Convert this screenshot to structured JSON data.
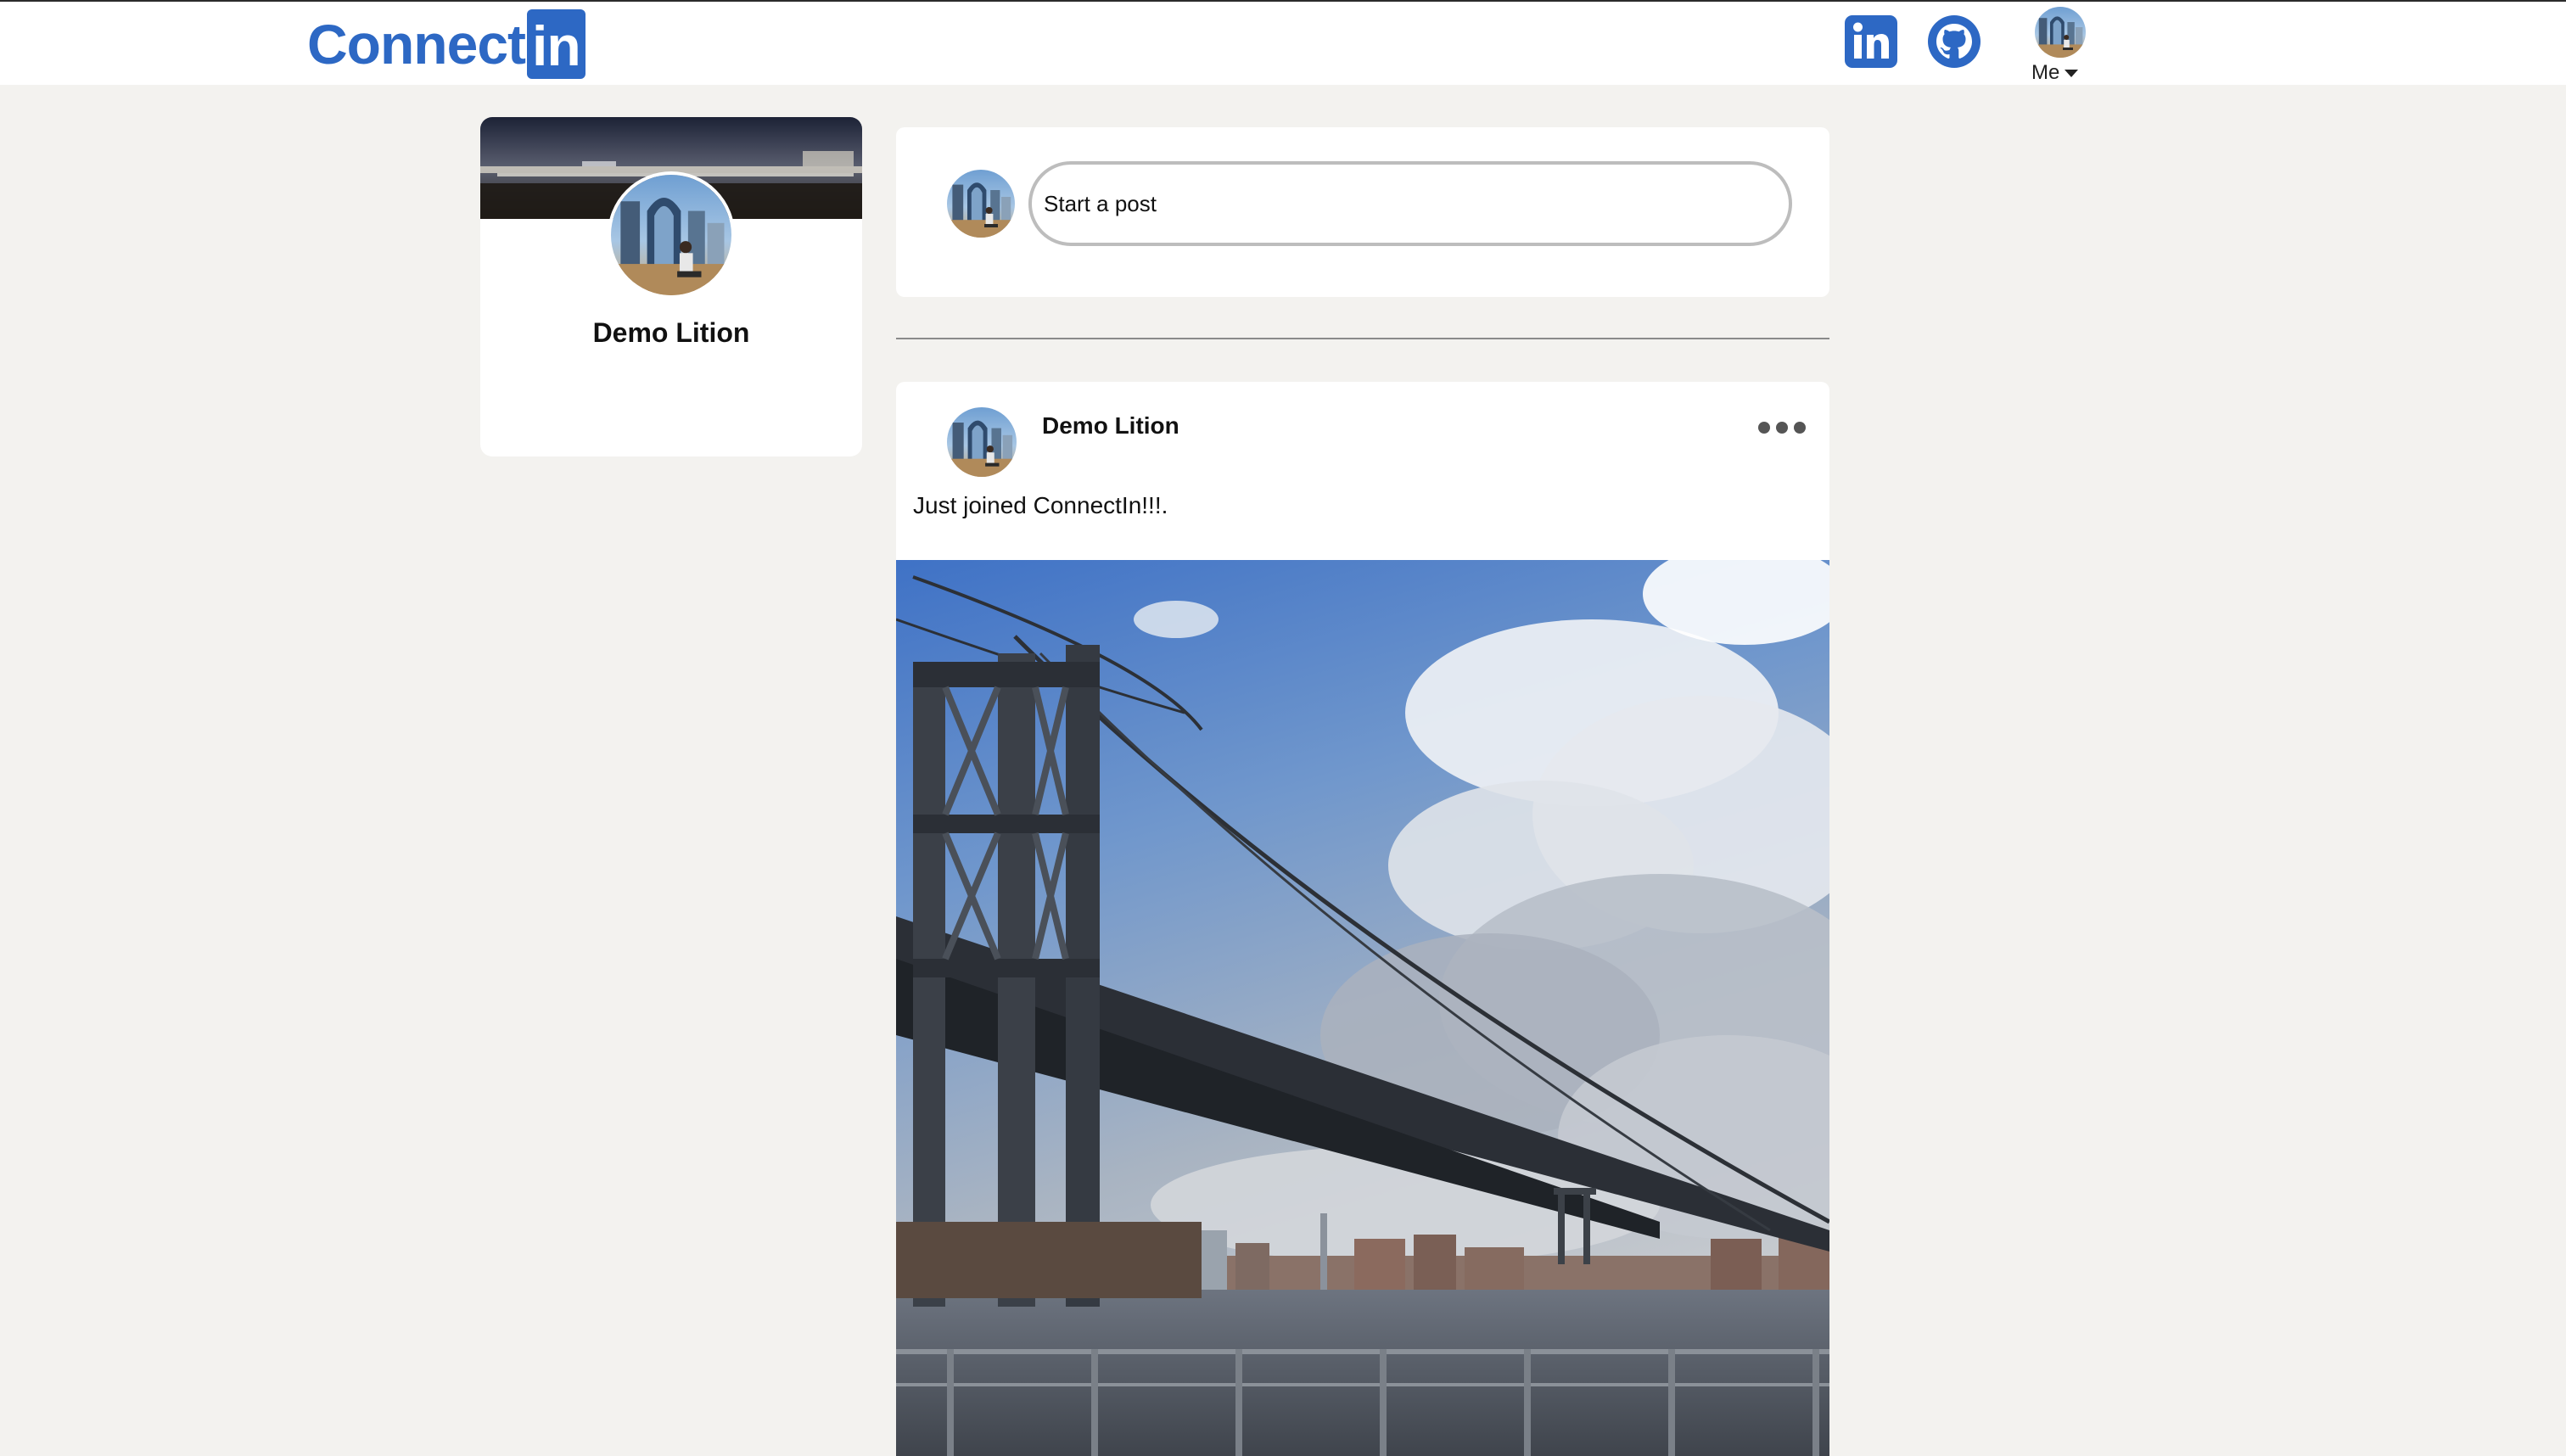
{
  "header": {
    "logo_text": "Connect",
    "logo_box_text": "in",
    "linkedin_icon": "linkedin-icon",
    "github_icon": "github-icon",
    "me_label": "Me"
  },
  "profile": {
    "name": "Demo Lition"
  },
  "composer": {
    "placeholder": "Start a post"
  },
  "post": {
    "author": "Demo Lition",
    "text": "Just joined ConnectIn!!!.",
    "menu_icon": "more-options-icon"
  },
  "colors": {
    "brand": "#2d68c4",
    "background": "#f3f2ef",
    "card": "#ffffff"
  }
}
